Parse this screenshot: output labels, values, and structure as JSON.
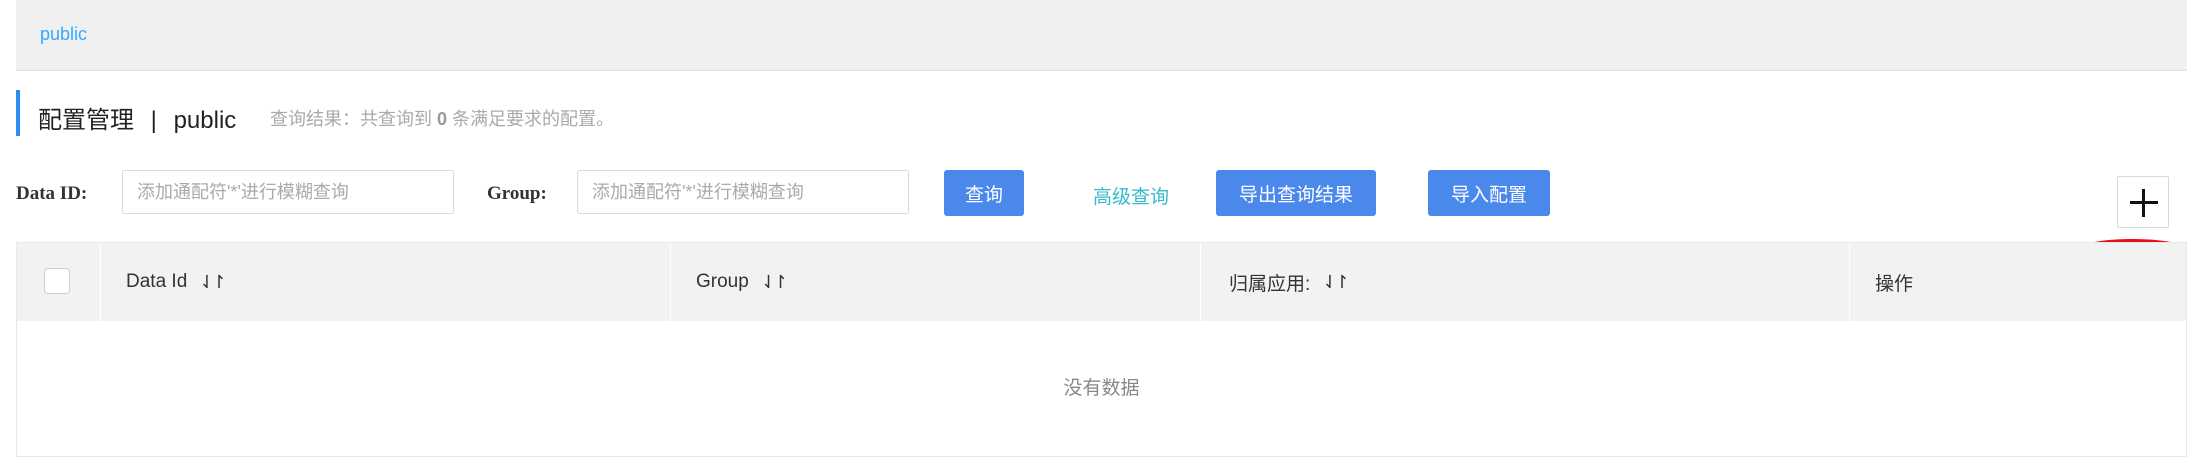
{
  "namespace": {
    "tab": "public"
  },
  "header": {
    "title": "配置管理",
    "separator": "|",
    "namespace": "public",
    "result_prefix": "查询结果：共查询到",
    "result_count": "0",
    "result_suffix": "条满足要求的配置。"
  },
  "search": {
    "data_id_label": "Data ID:",
    "data_id_placeholder": "添加通配符'*'进行模糊查询",
    "group_label": "Group:",
    "group_placeholder": "添加通配符'*'进行模糊查询",
    "query_button": "查询",
    "advanced_link": "高级查询",
    "export_button": "导出查询结果",
    "import_button": "导入配置"
  },
  "add_button": {
    "icon": "plus-icon"
  },
  "table": {
    "columns": [
      {
        "label": "Data Id",
        "sortable": true
      },
      {
        "label": "Group",
        "sortable": true
      },
      {
        "label": "归属应用:",
        "sortable": true
      },
      {
        "label": "操作",
        "sortable": false
      }
    ],
    "sort_glyph": "⇃↾",
    "empty_text": "没有数据"
  },
  "colors": {
    "accent": "#2d8cf0",
    "button": "#4a88ec",
    "link": "#33bbcc",
    "annotation": "#e8101a"
  }
}
